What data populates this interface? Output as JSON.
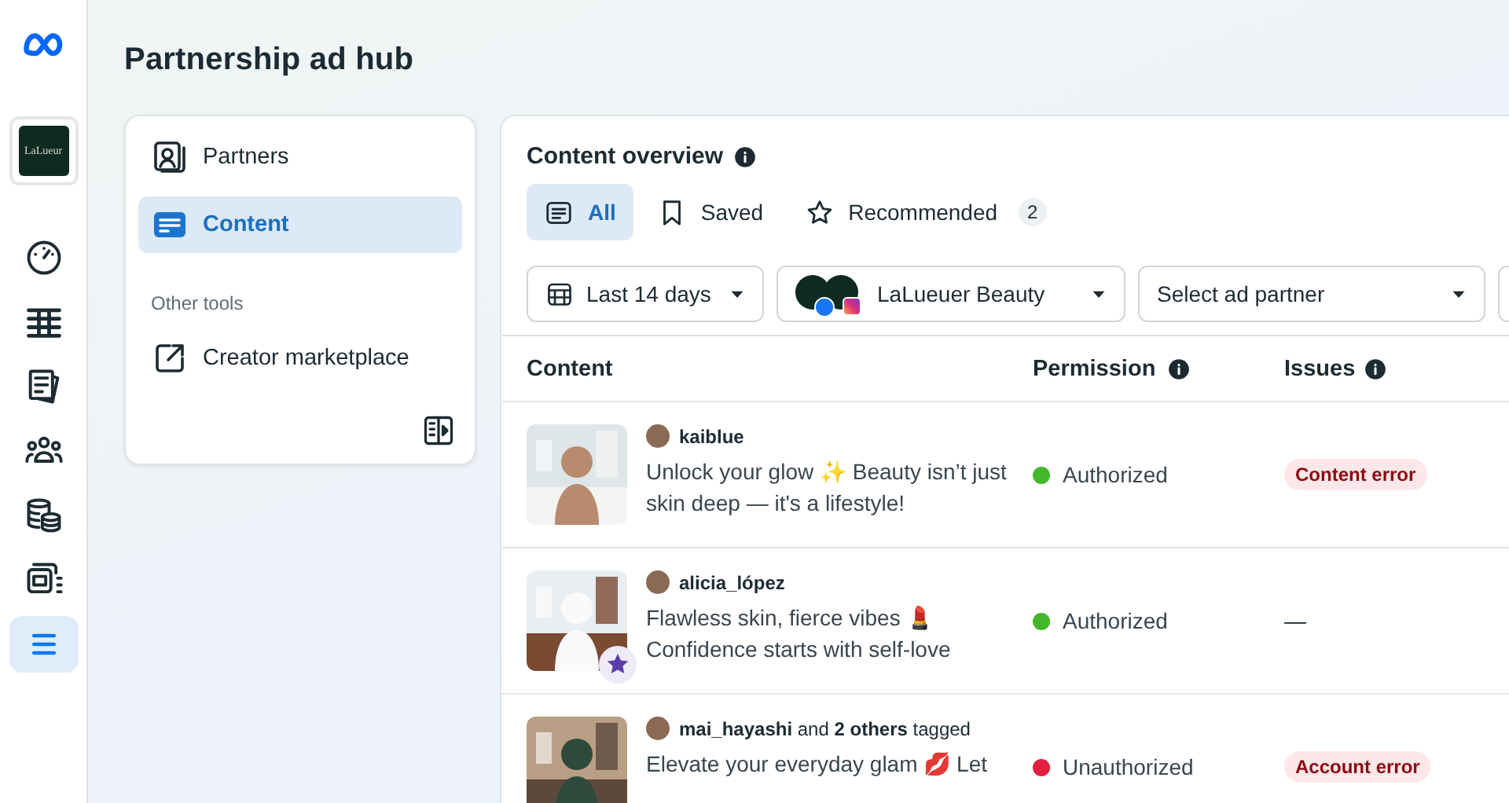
{
  "rail": {
    "brand": "LaLueur",
    "items": [
      {
        "kind": "gauge",
        "selected": false
      },
      {
        "kind": "table",
        "selected": false
      },
      {
        "kind": "pages",
        "selected": false
      },
      {
        "kind": "people",
        "selected": false
      },
      {
        "kind": "coins",
        "selected": false
      },
      {
        "kind": "media",
        "selected": false
      },
      {
        "kind": "menu",
        "selected": true
      }
    ]
  },
  "title": "Partnership ad hub",
  "nav": {
    "items": [
      {
        "label": "Partners",
        "kind": "portrait",
        "selected": false
      },
      {
        "label": "Content",
        "kind": "content",
        "selected": true
      }
    ],
    "section": "Other tools",
    "tools": [
      {
        "label": "Creator marketplace",
        "kind": "external"
      }
    ]
  },
  "overview": {
    "title": "Content overview",
    "tabs": [
      {
        "label": "All",
        "kind": "list",
        "selected": true
      },
      {
        "label": "Saved",
        "kind": "bookmark",
        "selected": false
      },
      {
        "label": "Recommended",
        "kind": "star",
        "selected": false,
        "count": "2"
      }
    ],
    "filters": [
      {
        "kind": "date",
        "label": "Last 14 days"
      },
      {
        "kind": "account",
        "label": "LaLueuer Beauty"
      },
      {
        "kind": "plain",
        "label": "Select ad partner"
      },
      {
        "kind": "blank"
      }
    ],
    "columns": [
      "Content",
      "Permission",
      "Issues"
    ],
    "rows": [
      {
        "author": "**kaiblue**",
        "caption": "Unlock your glow ✨ Beauty isn’t just skin deep — it's a lifestyle!",
        "starred": false,
        "permission": "Authorized",
        "color": "#42b72a",
        "issue": {
          "kind": "badge",
          "text": "Content error"
        }
      },
      {
        "author": "**alicia_lópez**",
        "caption": "Flawless skin, fierce vibes 💄 Confidence starts with self-love",
        "starred": true,
        "permission": "Authorized",
        "color": "#42b72a",
        "issue": {
          "kind": "text",
          "text": "—"
        }
      },
      {
        "author": "**mai_hayashi** and **2 others** tagged",
        "caption": "Elevate your everyday glam 💋 Let",
        "starred": false,
        "permission": "Unauthorized",
        "color": "#e41e3f",
        "issue": {
          "kind": "badge",
          "text": "Account error"
        }
      }
    ]
  }
}
